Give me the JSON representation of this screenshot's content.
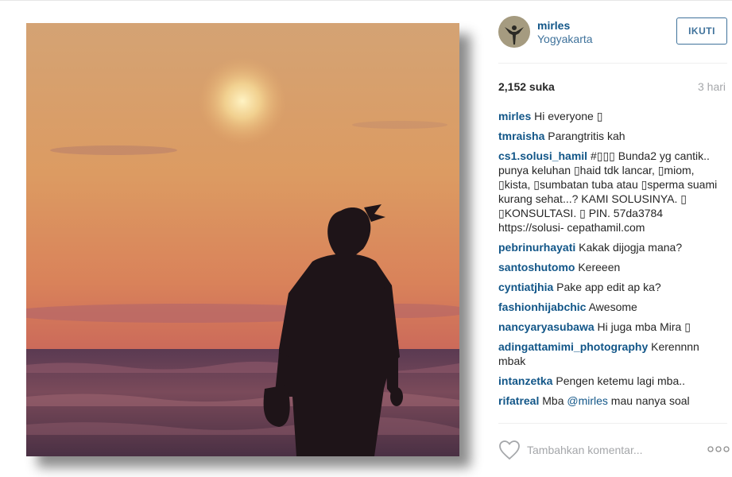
{
  "colors": {
    "link": "#125688",
    "accent": "#3f729b",
    "muted": "#a5a7aa",
    "text": "#262626"
  },
  "post": {
    "photo_icon": "post-photo"
  },
  "header": {
    "username": "mirles",
    "location": "Yogyakarta",
    "follow_label": "IKUTI"
  },
  "stats": {
    "likes": "2,152 suka",
    "time": "3 hari"
  },
  "comments": [
    {
      "user": "mirles",
      "text": " Hi everyone ▯"
    },
    {
      "user": "tmraisha",
      "text": " Parangtritis kah"
    },
    {
      "user": "cs1.solusi_hamil",
      "text": " #▯▯▯ Bunda2 yg cantik.. punya keluhan ▯haid tdk lancar, ▯miom, ▯kista, ▯sumbatan tuba atau ▯sperma suami kurang sehat...? KAMI SOLUSINYA. ▯ ▯KONSULTASI. ▯ PIN. 57da3784 https://solusi- cepathamil.com"
    },
    {
      "user": "pebrinurhayati",
      "text": " Kakak dijogja mana?"
    },
    {
      "user": "santoshutomo",
      "text": " Kereeen"
    },
    {
      "user": "cyntiatjhia",
      "text": " Pake app edit ap ka?"
    },
    {
      "user": "fashionhijabchic",
      "text": " Awesome"
    },
    {
      "user": "nancyaryasubawa",
      "text": " Hi juga mba Mira ▯"
    },
    {
      "user": "adingattamimi_photography",
      "text": " Kerennnn mbak"
    },
    {
      "user": "intanzetka",
      "text": " Pengen ketemu lagi mba.."
    },
    {
      "user": "rifatreal",
      "text": " Mba ",
      "mention": "@mirles",
      "tail": " mau nanya soal"
    }
  ],
  "footer": {
    "comment_placeholder": "Tambahkan komentar...",
    "heart_icon": "heart-icon",
    "more_icon": "more-options-icon"
  }
}
